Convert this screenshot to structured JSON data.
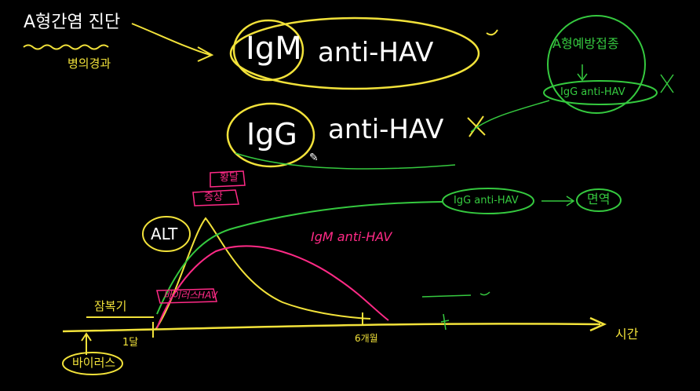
{
  "board": {
    "title": "A형간염 진단",
    "subtitle": "병의경과",
    "igm_label": "IgM",
    "igm_antibody": "anti-HAV",
    "igg_label": "IgG",
    "igg_antibody": "anti-HAV",
    "vaccine_title": "A형예방접종",
    "vaccine_result": "IgG anti-HAV",
    "immunity_antibody": "IgG anti-HAV",
    "immunity": "면역",
    "jaundice": "황달",
    "symptoms": "증상",
    "alt": "ALT",
    "igm_curve_label": "IgM anti-HAV",
    "virus_excretion": "바이러스HAV",
    "incubation": "잠복기",
    "one_month": "1달",
    "six_months": "6개월",
    "time": "시간",
    "virus": "바이러스"
  },
  "colors": {
    "white": "#ffffff",
    "yellow": "#f2e23a",
    "green": "#35c93f",
    "pink": "#ff2a86"
  }
}
